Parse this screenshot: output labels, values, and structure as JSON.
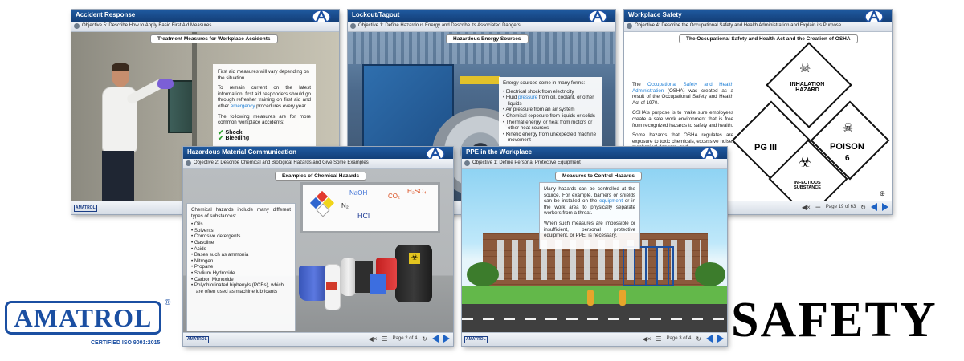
{
  "windows": {
    "accident": {
      "title": "Accident Response",
      "objective": "Objective 5: Describe How to Apply Basic First Aid Measures",
      "pill": "Treatment Measures for Workplace Accidents",
      "p1": "First aid measures will vary depending on the situation.",
      "p2_a": "To remain current on the latest information, first aid responders should go through refresher training on first aid and other ",
      "p2_link": "emergency",
      "p2_b": " procedures every year.",
      "p3": "The following measures are for more common workplace accidents:",
      "checks": [
        "Shock",
        "Bleeding"
      ]
    },
    "lockout": {
      "title": "Lockout/Tagout",
      "objective": "Objective 1: Define Hazardous Energy and Describe its Associated Dangers",
      "pill": "Hazardous Energy Sources",
      "intro": "Energy sources come in many forms:",
      "items": [
        {
          "a": "Electrical shock from electricity",
          "link": "",
          "b": ""
        },
        {
          "a": "Fluid ",
          "link": "pressure",
          "b": " from oil, coolant, or other liquids"
        },
        {
          "a": "Air pressure from an air system",
          "link": "",
          "b": ""
        },
        {
          "a": "Chemical exposure from liquids or solids",
          "link": "",
          "b": ""
        },
        {
          "a": "Thermal energy, or heat from motors or other heat sources",
          "link": "",
          "b": ""
        },
        {
          "a": "Kinetic energy from unexpected machine movement",
          "link": "",
          "b": ""
        }
      ]
    },
    "workplace": {
      "title": "Workplace Safety",
      "objective": "Objective 4: Describe the Occupational Safety and Health Administration and Explain its Purpose",
      "pill": "The Occupational Safety and Health Act and the Creation of OSHA",
      "p1_a": "The ",
      "p1_link": "Occupational Safety and Health Administration",
      "p1_b": " (OSHA) was created as a result of the Occupational Safety and Health Act of 1970.",
      "p2": "OSHA's purpose is to make sure employees create a safe work environment that is free from recognized hazards to safety and health.",
      "p3": "Some hazards that OSHA regulates are exposure to toxic chemicals, excessive noise, mechanical dangers, and",
      "placards": {
        "inhalation": "INHALATION HAZARD",
        "pg": "PG III",
        "poison": "POISON",
        "infectious": "INFECTIOUS SUBSTANCE",
        "n6": "6"
      },
      "page": "Page 19 of 63"
    },
    "hazmat": {
      "title": "Hazardous Material Communication",
      "objective": "Objective 2: Describe Chemical and Biological Hazards and Give Some Examples",
      "pill": "Examples of Chemical Hazards",
      "intro": "Chemical hazards include many different types of substances:",
      "items": [
        "Oils",
        "Solvents",
        "Corrosive detergents",
        "Gasoline",
        "Acids",
        "Bases such as ammonia",
        "Nitrogen",
        "Propane",
        "Sodium Hydroxide",
        "Carbon Monoxide",
        "Polychlorinated biphenyls (PCBs), which are often used as machine lubricants"
      ],
      "board": {
        "naoh": "NaOH",
        "co2": "CO₂",
        "h2so4": "H₂SO₄",
        "n2": "N₂",
        "hcl": "HCl",
        "nfpa": [
          "3",
          "1",
          "1",
          "W"
        ]
      },
      "page": "Page 2 of 4"
    },
    "ppe": {
      "title": "PPE in the Workplace",
      "objective": "Objective 1: Define Personal Protective Equipment",
      "pill": "Measures to Control Hazards",
      "p1_a": "Many hazards can be controlled at the source. For example, barriers or shields can be installed on the ",
      "p1_link": "equipment",
      "p1_b": " or in the work area to physically separate workers from a threat.",
      "p2": "When such measures are impossible or insufficient, personal protective equipment, or PPE, is necessary.",
      "page": "Page 3 of 4"
    }
  },
  "amatrol_small": "AMATROL",
  "brand": {
    "name": "AMATROL",
    "registered": "®",
    "cert": "CERTIFIED ISO 9001:2015"
  },
  "headline": "SAFETY",
  "colors": {
    "titlebar": "#1a4d8f",
    "accent": "#1e63c4",
    "link": "#1e7fd6",
    "brand": "#1b4fa2"
  }
}
